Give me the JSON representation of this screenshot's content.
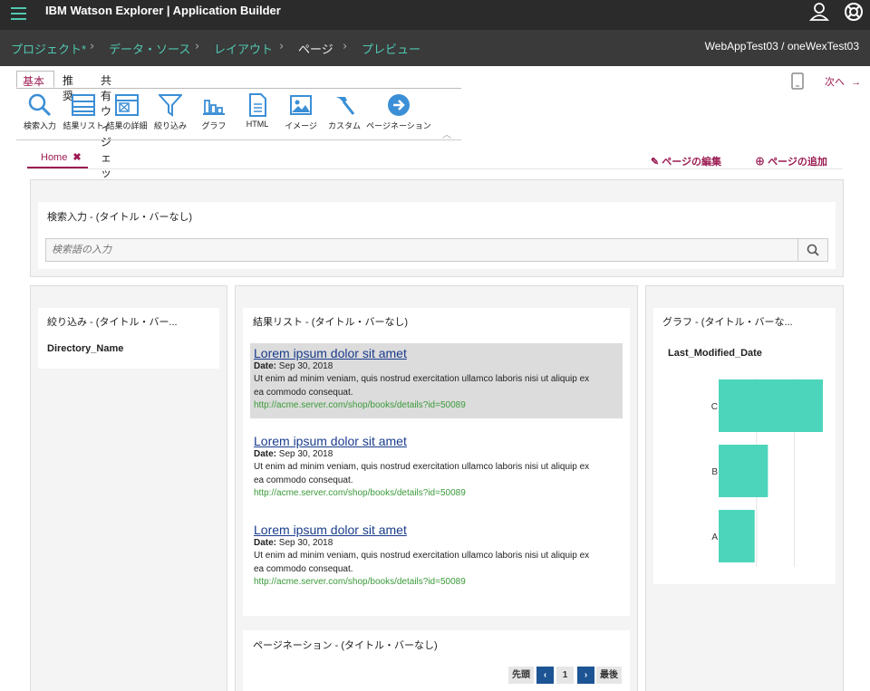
{
  "header": {
    "app_title": "IBM Watson Explorer | Application Builder",
    "breadcrumbs": [
      "プロジェクト*",
      "データ・ソース",
      "レイアウト",
      "ページ",
      "プレビュー"
    ],
    "environment": "WebAppTest03 / oneWexTest03"
  },
  "palette": {
    "tabs": [
      "基本",
      "推奨",
      "共有ウィジェット"
    ],
    "widgets": [
      "検索入力",
      "結果リスト",
      "結果の詳細",
      "絞り込み",
      "グラフ",
      "HTML",
      "イメージ",
      "カスタム",
      "ページネーション"
    ]
  },
  "nav": {
    "next_label": "次へ"
  },
  "page_tabs": {
    "home": "Home"
  },
  "actions": {
    "edit_page": "ページの編集",
    "add_page": "ページの追加"
  },
  "search_widget": {
    "title": "検索入力 - (タイトル・バーなし)",
    "placeholder": "検索語の入力"
  },
  "refine_widget": {
    "title": "絞り込み - (タイトル・バー...",
    "field": "Directory_Name"
  },
  "results_widget": {
    "title": "結果リスト - (タイトル・バーなし)",
    "items": [
      {
        "title": "Lorem ipsum dolor sit amet",
        "date_label": "Date:",
        "date": "Sep 30, 2018",
        "body_line1": "Ut enim ad minim veniam, quis nostrud exercitation ullamco laboris nisi ut aliquip ex",
        "body_line2": "ea commodo consequat.",
        "url": "http://acme.server.com/shop/books/details?id=50089"
      },
      {
        "title": "Lorem ipsum dolor sit amet",
        "date_label": "Date:",
        "date": "Sep 30, 2018",
        "body_line1": "Ut enim ad minim veniam, quis nostrud exercitation ullamco laboris nisi ut aliquip ex",
        "body_line2": "ea commodo consequat.",
        "url": "http://acme.server.com/shop/books/details?id=50089"
      },
      {
        "title": "Lorem ipsum dolor sit amet",
        "date_label": "Date:",
        "date": "Sep 30, 2018",
        "body_line1": "Ut enim ad minim veniam, quis nostrud exercitation ullamco laboris nisi ut aliquip ex",
        "body_line2": "ea commodo consequat.",
        "url": "http://acme.server.com/shop/books/details?id=50089"
      }
    ]
  },
  "pagination_widget": {
    "title": "ページネーション - (タイトル・バーなし)",
    "first": "先頭",
    "page": "1",
    "last": "最後"
  },
  "chart_widget": {
    "title": "グラフ - (タイトル・バーな...",
    "field": "Last_Modified_Date"
  },
  "chart_data": {
    "type": "bar",
    "orientation": "horizontal",
    "categories": [
      "C",
      "B",
      "A"
    ],
    "values": [
      2.75,
      1.3,
      0.95
    ],
    "xlim": [
      0,
      2.75
    ],
    "grid": true,
    "color": "#4dd5bb"
  },
  "colors": {
    "accent": "#9b1b52",
    "teal": "#4fc8b0",
    "link": "#1a3c8c",
    "url": "#3a9a3a",
    "pager": "#1c5494"
  }
}
